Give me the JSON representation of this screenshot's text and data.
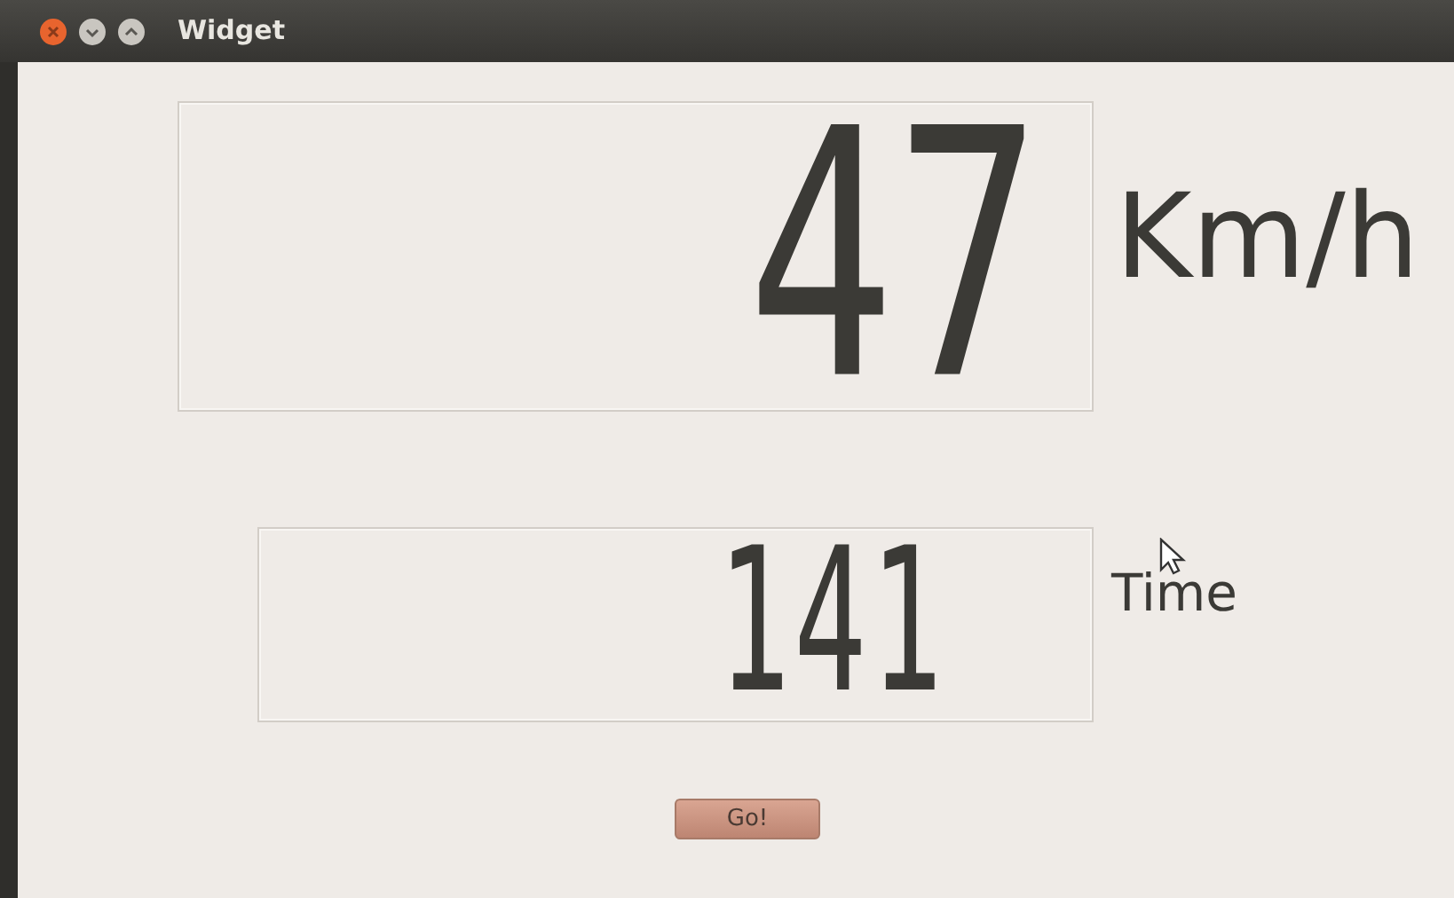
{
  "window": {
    "title": "Widget"
  },
  "displays": [
    {
      "value": "47",
      "unit": "Km/h",
      "kind": "large"
    },
    {
      "value": "141",
      "unit": "Time",
      "kind": "small"
    }
  ],
  "button": {
    "label": "Go!"
  }
}
